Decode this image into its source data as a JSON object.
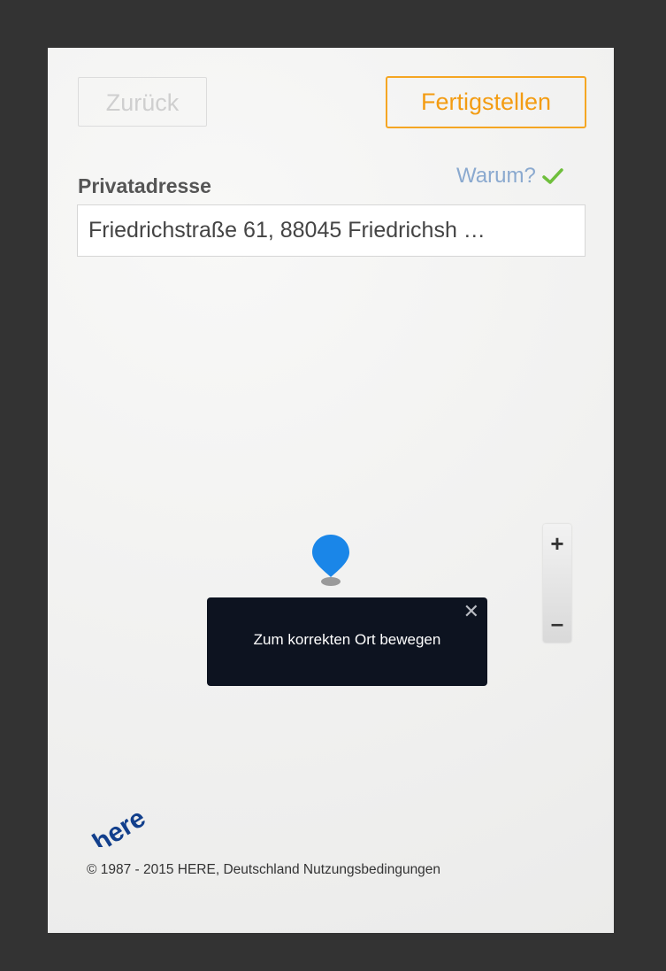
{
  "buttons": {
    "back_label": "Zurück",
    "finish_label": "Fertigstellen"
  },
  "address": {
    "label": "Privatadresse",
    "why_label": "Warum?",
    "value": "Friedrichstraße 61, 88045 Friedrichsh …"
  },
  "map": {
    "zoom_in_label": "+",
    "zoom_out_label": "–",
    "tooltip_text": "Zum korrekten Ort bewegen",
    "tooltip_close": "✕",
    "logo_text": "here",
    "copyright": "© 1987 - 2015 HERE, Deutschland Nutzungsbedingungen"
  },
  "colors": {
    "accent": "#f39c12",
    "link": "#8aa9cf",
    "check": "#6fbf3c",
    "pin": "#1a86e8",
    "tooltip_bg": "#0d1320"
  },
  "icons": {
    "check": "check-icon",
    "pin": "map-pin-icon",
    "close": "close-icon"
  }
}
